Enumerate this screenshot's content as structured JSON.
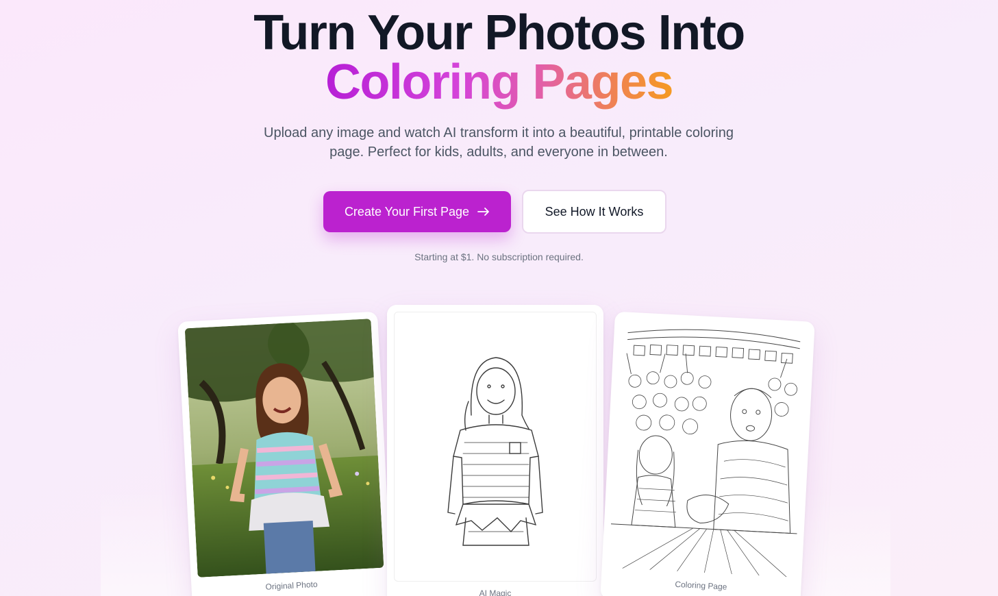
{
  "hero": {
    "headline_line1": "Turn Your Photos Into",
    "headline_line2": "Coloring Pages",
    "subtitle": "Upload any image and watch AI transform it into a beautiful, printable coloring page. Perfect for kids, adults, and everyone in between.",
    "primary_cta_label": "Create Your First Page",
    "primary_cta_icon": "arrow-right-icon",
    "secondary_cta_label": "See How It Works",
    "pricing_note": "Starting at $1. No subscription required."
  },
  "showcase": {
    "cards": [
      {
        "caption": "Original Photo"
      },
      {
        "caption": "AI Magic"
      },
      {
        "caption": "Coloring Page"
      }
    ]
  },
  "colors": {
    "headline": "#121826",
    "accent_primary": "#bb22cf",
    "gradient_start": "#b61fd6",
    "gradient_end": "#f59a22",
    "background": "#fbe8fb"
  }
}
